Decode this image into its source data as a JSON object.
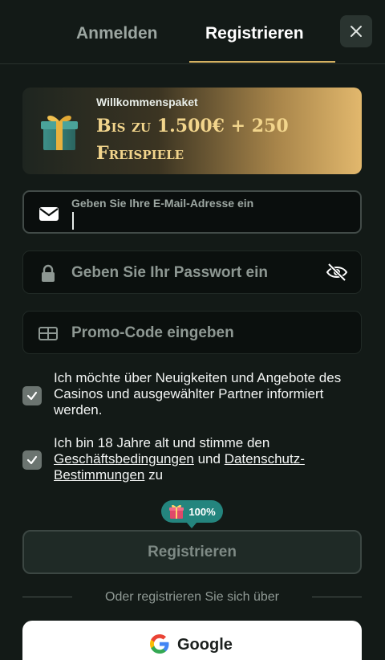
{
  "tabs": {
    "login": "Anmelden",
    "register": "Registrieren"
  },
  "promo": {
    "label": "Willkommenspaket",
    "headline": "Bis zu 1.500€ + 250 Freispiele"
  },
  "form": {
    "email_placeholder": "Geben Sie Ihre E-Mail-Adresse ein",
    "password_placeholder": "Geben Sie Ihr Passwort ein",
    "promo_placeholder": "Promo-Code eingeben"
  },
  "consents": {
    "news": "Ich möchte über Neuigkeiten und Angebote des Casinos und ausgewählter Partner informiert werden.",
    "terms_prefix": "Ich bin 18 Jahre alt und stimme den",
    "terms_link": "Geschäftsbedingungen",
    "terms_and": "und",
    "privacy_link": "Datenschutz-Bestimmungen",
    "terms_suffix": "zu"
  },
  "bonus_badge": "100%",
  "submit_label": "Registrieren",
  "divider_text": "Oder registrieren Sie sich über",
  "social": {
    "google_label": "Google"
  },
  "colors": {
    "accent_gold": "#d4b161",
    "badge_teal": "#24857e",
    "checkbox": "#6b7470"
  }
}
